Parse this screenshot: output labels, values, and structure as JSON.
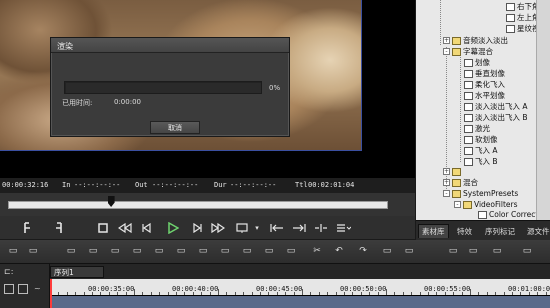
{
  "timecodes": {
    "current": "00:00:32:16",
    "in_label": "In",
    "in_value": "--:--:--:--",
    "out_label": "Out",
    "out_value": "--:--:--:--",
    "dur_label": "Dur",
    "dur_value": "--:--:--:--",
    "ttl_label": "Ttl",
    "ttl_value": "00:02:01:04"
  },
  "scrub_position_fraction": 0.27,
  "dialog": {
    "title": "渲染",
    "percent_label": "0%",
    "progress_fraction": 0.0,
    "elapsed_label": "已用时间:",
    "elapsed_value": "0:00:00",
    "cancel_label": "取消"
  },
  "tree": {
    "top_items": [
      "右下角夹",
      "左上角大",
      "星纹视角"
    ],
    "group1": "音频淡入淡出",
    "group2": "字幕混合",
    "items": [
      "划像",
      "垂直划像",
      "柔化飞入",
      "水平划像",
      "淡入淡出飞入 A",
      "淡入淡出飞入 B",
      "激光",
      "软划像",
      "飞入 A",
      "飞入 B"
    ],
    "blank_folder": "",
    "mix": "混合",
    "system_presets": "SystemPresets",
    "video_filters": "VideoFilters",
    "color_correction": "Color Correctio"
  },
  "panel_tabs": [
    "素材库",
    "特效",
    "序列标记",
    "源文件"
  ],
  "sequence_tab": "序列1",
  "ruler_labels": [
    "00:00:35:00",
    "00:00:40:00",
    "00:00:45:00",
    "00:00:50:00",
    "00:00:55:00",
    "00:01:00:00"
  ],
  "icons": {
    "transport": [
      "mark-in-icon",
      "mark-out-icon",
      "stop-icon",
      "rewind-icon",
      "step-back-icon",
      "play-icon",
      "step-forward-icon",
      "fast-forward-icon",
      "loop-icon",
      "go-in-icon",
      "go-out-icon",
      "split-icon",
      "more-icon"
    ]
  },
  "colors": {
    "progress": "#4d8ad6",
    "playhead": "#ff3b3b",
    "play": "#6fd36f"
  }
}
